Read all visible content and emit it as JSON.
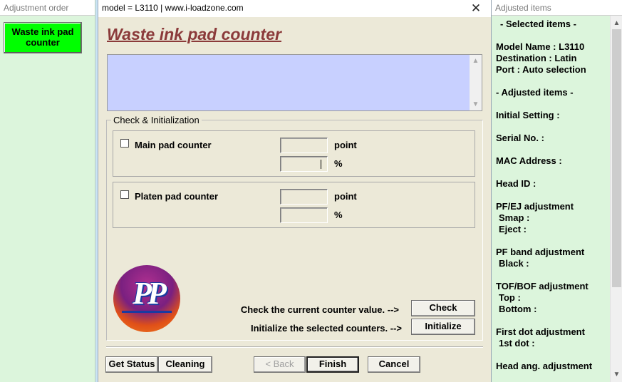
{
  "left_panel": {
    "title": "Adjustment order",
    "item_label": "Waste ink pad counter"
  },
  "dialog": {
    "title": "model = L3110 | www.i-loadzone.com",
    "close_glyph": "✕",
    "heading": "Waste ink pad counter",
    "group_label": "Check & Initialization",
    "main_pad_label": "Main pad counter",
    "platen_pad_label": "Platen pad counter",
    "unit_point": "point",
    "unit_percent": "%",
    "main_point_value": "",
    "main_percent_value": "",
    "platen_point_value": "",
    "platen_percent_value": "",
    "logo_letters": "PP",
    "check_instruction": "Check the current counter value. -->",
    "init_instruction": "Initialize the selected counters. -->",
    "check_button": "Check",
    "initialize_button": "Initialize",
    "get_status_button": "Get Status",
    "cleaning_button": "Cleaning",
    "back_button": "< Back",
    "finish_button": "Finish",
    "cancel_button": "Cancel"
  },
  "right_panel": {
    "title": "Adjusted items",
    "items": [
      "- Selected items -",
      "Model Name : L3110",
      "Destination : Latin",
      "Port : Auto selection",
      "- Adjusted items -",
      "Initial Setting :",
      "Serial No. :",
      "MAC Address :",
      "Head ID :",
      "PF/EJ adjustment",
      "Smap :",
      "Eject :",
      "PF band adjustment",
      "Black :",
      "TOF/BOF adjustment",
      "Top :",
      "Bottom :",
      "First dot adjustment",
      "1st dot :",
      "Head ang. adjustment"
    ]
  },
  "icons": {
    "scroll_up": "up-arrow-icon",
    "scroll_down": "down-arrow-icon",
    "close": "close-icon"
  },
  "colors": {
    "adjust_item_bg": "#00ff00",
    "heading": "#8b3a3a",
    "log_bg": "#c8d0ff",
    "panel_bg": "#dcf5dc",
    "dialog_bg": "#ece9d8"
  }
}
